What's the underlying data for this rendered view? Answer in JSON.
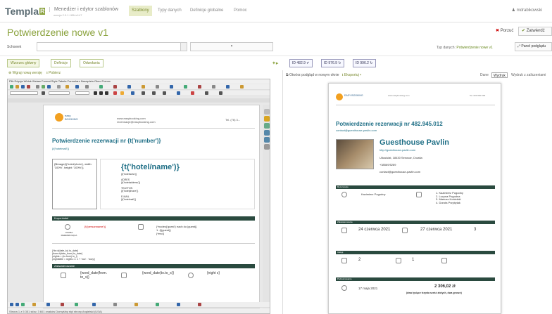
{
  "app": {
    "logo": "Templa",
    "logo_mark": "R",
    "title": "Menedżer i edytor szablonów",
    "version": "wersja 2.0.1.185/rc147"
  },
  "nav": [
    {
      "label": "Szablony"
    },
    {
      "label": "Typy danych"
    },
    {
      "label": "Definicje globalne"
    },
    {
      "label": "Pomoc"
    }
  ],
  "user": {
    "name": "mdrabikowski"
  },
  "page": {
    "title": "Potwierdzenie nowe v1",
    "cancel_label": "Porzuć",
    "save_label": "Zatwierdź"
  },
  "clipboard": {
    "label": "Schowek"
  },
  "datatype": {
    "prefix": "Typ danych:",
    "value": "Potwierdzenie nowe v1",
    "preview_label": "Panel podglądu"
  },
  "tabs": [
    {
      "label": "Wzorzec główny"
    },
    {
      "label": "Definicje"
    },
    {
      "label": "Odwołania"
    }
  ],
  "links": {
    "new_version": "Wgraj nową wersję",
    "download": "Pobierz",
    "open_preview": "Otwórz podgląd w nowym oknie",
    "export": "Eksportuj"
  },
  "record_tabs": [
    {
      "label": "ID 482.9"
    },
    {
      "label": "ID 976.9"
    },
    {
      "label": "ID 996.2"
    }
  ],
  "preview_tabs": [
    {
      "label": "Dane"
    },
    {
      "label": "Wydruk"
    },
    {
      "label": "Wydruk z zaliczeniami"
    }
  ],
  "editor": {
    "menu": "Plik  Edycja  Widok  Wstaw  Format  Style  Tabela  Formularz  Narzędzia  Okno  Pomoc",
    "status": "Strona 1 z 5    351 słów, 3 601 znaków    Domyślny styl strony    Angielski (USA)",
    "doc_contact": "www.easybooking.com\nrezerwacje@easybooking.com",
    "doc_phone": "Tel. (76) 3...",
    "title": "Potwierdzenie rezerwacji nr {t('number')}",
    "subtitle": "{t('hotelmail')}",
    "image_expr": "{$image(t('hotel/photo'), width: '100%', height: '100%')}",
    "hotel_name": "{t('hotel/name')}",
    "hotel_lines": "{t('hotelwww')}\n\nADRES\n{t('hoteladdress')}\n\nTELEFON\n{t('hotelphone')}\n\nE-MAIL\n{t('hotelmail')}",
    "section_guests": "Kuponhotel",
    "person_label": "OSOBA REZERWUJĄCA",
    "person_expr": "{t('personname')}",
    "rooms_expr": "{*nodes('guest') each do |guest|}\n1.  {t(guest)}\n{*end}",
    "script_lines": "{%n=t(date_to) to_date}\n{from=t(date_from) to_date}\n{nights = (to-from) to_i}\n{nightstitle = nights == 1 ? 'noc' : 'nocy'}",
    "section_dates": "Zakwaterowanie",
    "word_date_from": "{word_date(from. to_s)}",
    "word_date_to": "{word_date(to.to_s)}",
    "nights": "{night s}"
  },
  "preview": {
    "company": "EASY BOOKING",
    "title": "Potwierdzenie rezerwacji nr 482.945.012",
    "email": "contact@guesthouse-pavlin.com",
    "hotel": "Guesthouse Pavlin",
    "hotel_www": "http://guesthouse-pavlin.com",
    "hotel_address": "Ulica/ulat, 18430 Senovar, Croatia",
    "hotel_phone": "+38569/5289",
    "hotel_mail": "contact@guesthouse-pavlin.com",
    "sec1": "Rezerwacja",
    "guest_person": "Kazimierz Pogodny",
    "guests_list": "1. Kazimierz Pogodny\n2. Lucyna Pogodna\n3. Mariusz Kobielski\n4. Dorota Przybylak",
    "sec2": "Zakwaterowanie",
    "date_from": "24 czerwca 2021",
    "date_to": "27 czerwca 2021",
    "nights": "3",
    "sec3": "Usługi",
    "services_count": "2",
    "services_count2": "1",
    "sec4": "Podsumowanie",
    "pay_date": "17 maja 2021",
    "total": "2 306,02 zł",
    "total_note": "(dwa tysiące trzysta sześć złotych, dwa grosze)"
  },
  "colors": {
    "brand": "#8aa23c",
    "doc_teal": "#1f6f86",
    "section_dark": "#2a4a3f"
  }
}
